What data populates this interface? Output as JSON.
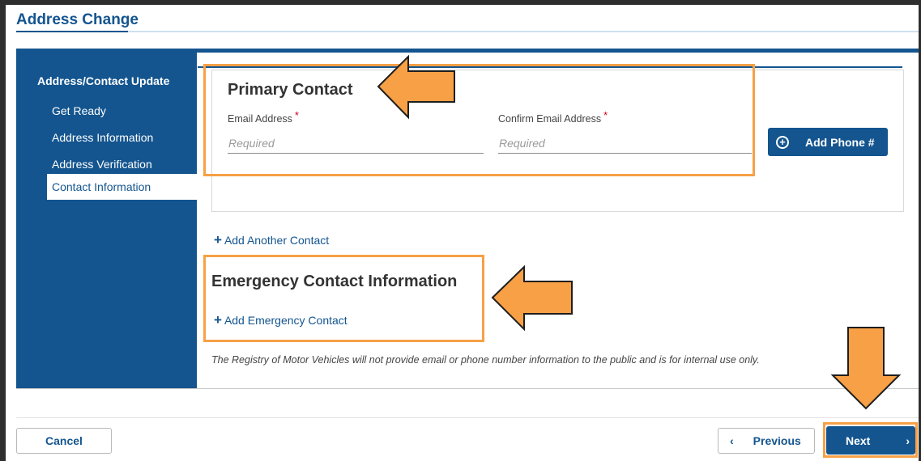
{
  "app": {
    "title": "Address Change"
  },
  "sidebar": {
    "heading": "Address/Contact Update",
    "items": [
      {
        "label": "Get Ready",
        "active": false
      },
      {
        "label": "Address Information",
        "active": false
      },
      {
        "label": "Address Verification",
        "active": false
      },
      {
        "label": "Contact Information",
        "active": true
      }
    ]
  },
  "primary_contact": {
    "title": "Primary Contact",
    "email": {
      "label": "Email Address",
      "placeholder": "Required",
      "value": ""
    },
    "confirm_email": {
      "label": "Confirm Email Address",
      "placeholder": "Required",
      "value": ""
    },
    "required_marker": "*",
    "add_phone_label": "Add Phone #",
    "add_phone_icon": "plus-circle-icon"
  },
  "add_another_contact": {
    "plus": "+",
    "label": "Add Another Contact"
  },
  "emergency": {
    "title": "Emergency Contact Information",
    "add_label": "Add Emergency Contact",
    "plus": "+"
  },
  "notice": "The Registry of Motor Vehicles will not provide email or phone number information to the public and is for internal use only.",
  "footer": {
    "cancel_label": "Cancel",
    "previous_label": "Previous",
    "previous_icon": "‹",
    "next_label": "Next",
    "next_icon": "›"
  },
  "colors": {
    "brand": "#14558f",
    "annotation": "#f7a046",
    "required": "#d0021b"
  }
}
